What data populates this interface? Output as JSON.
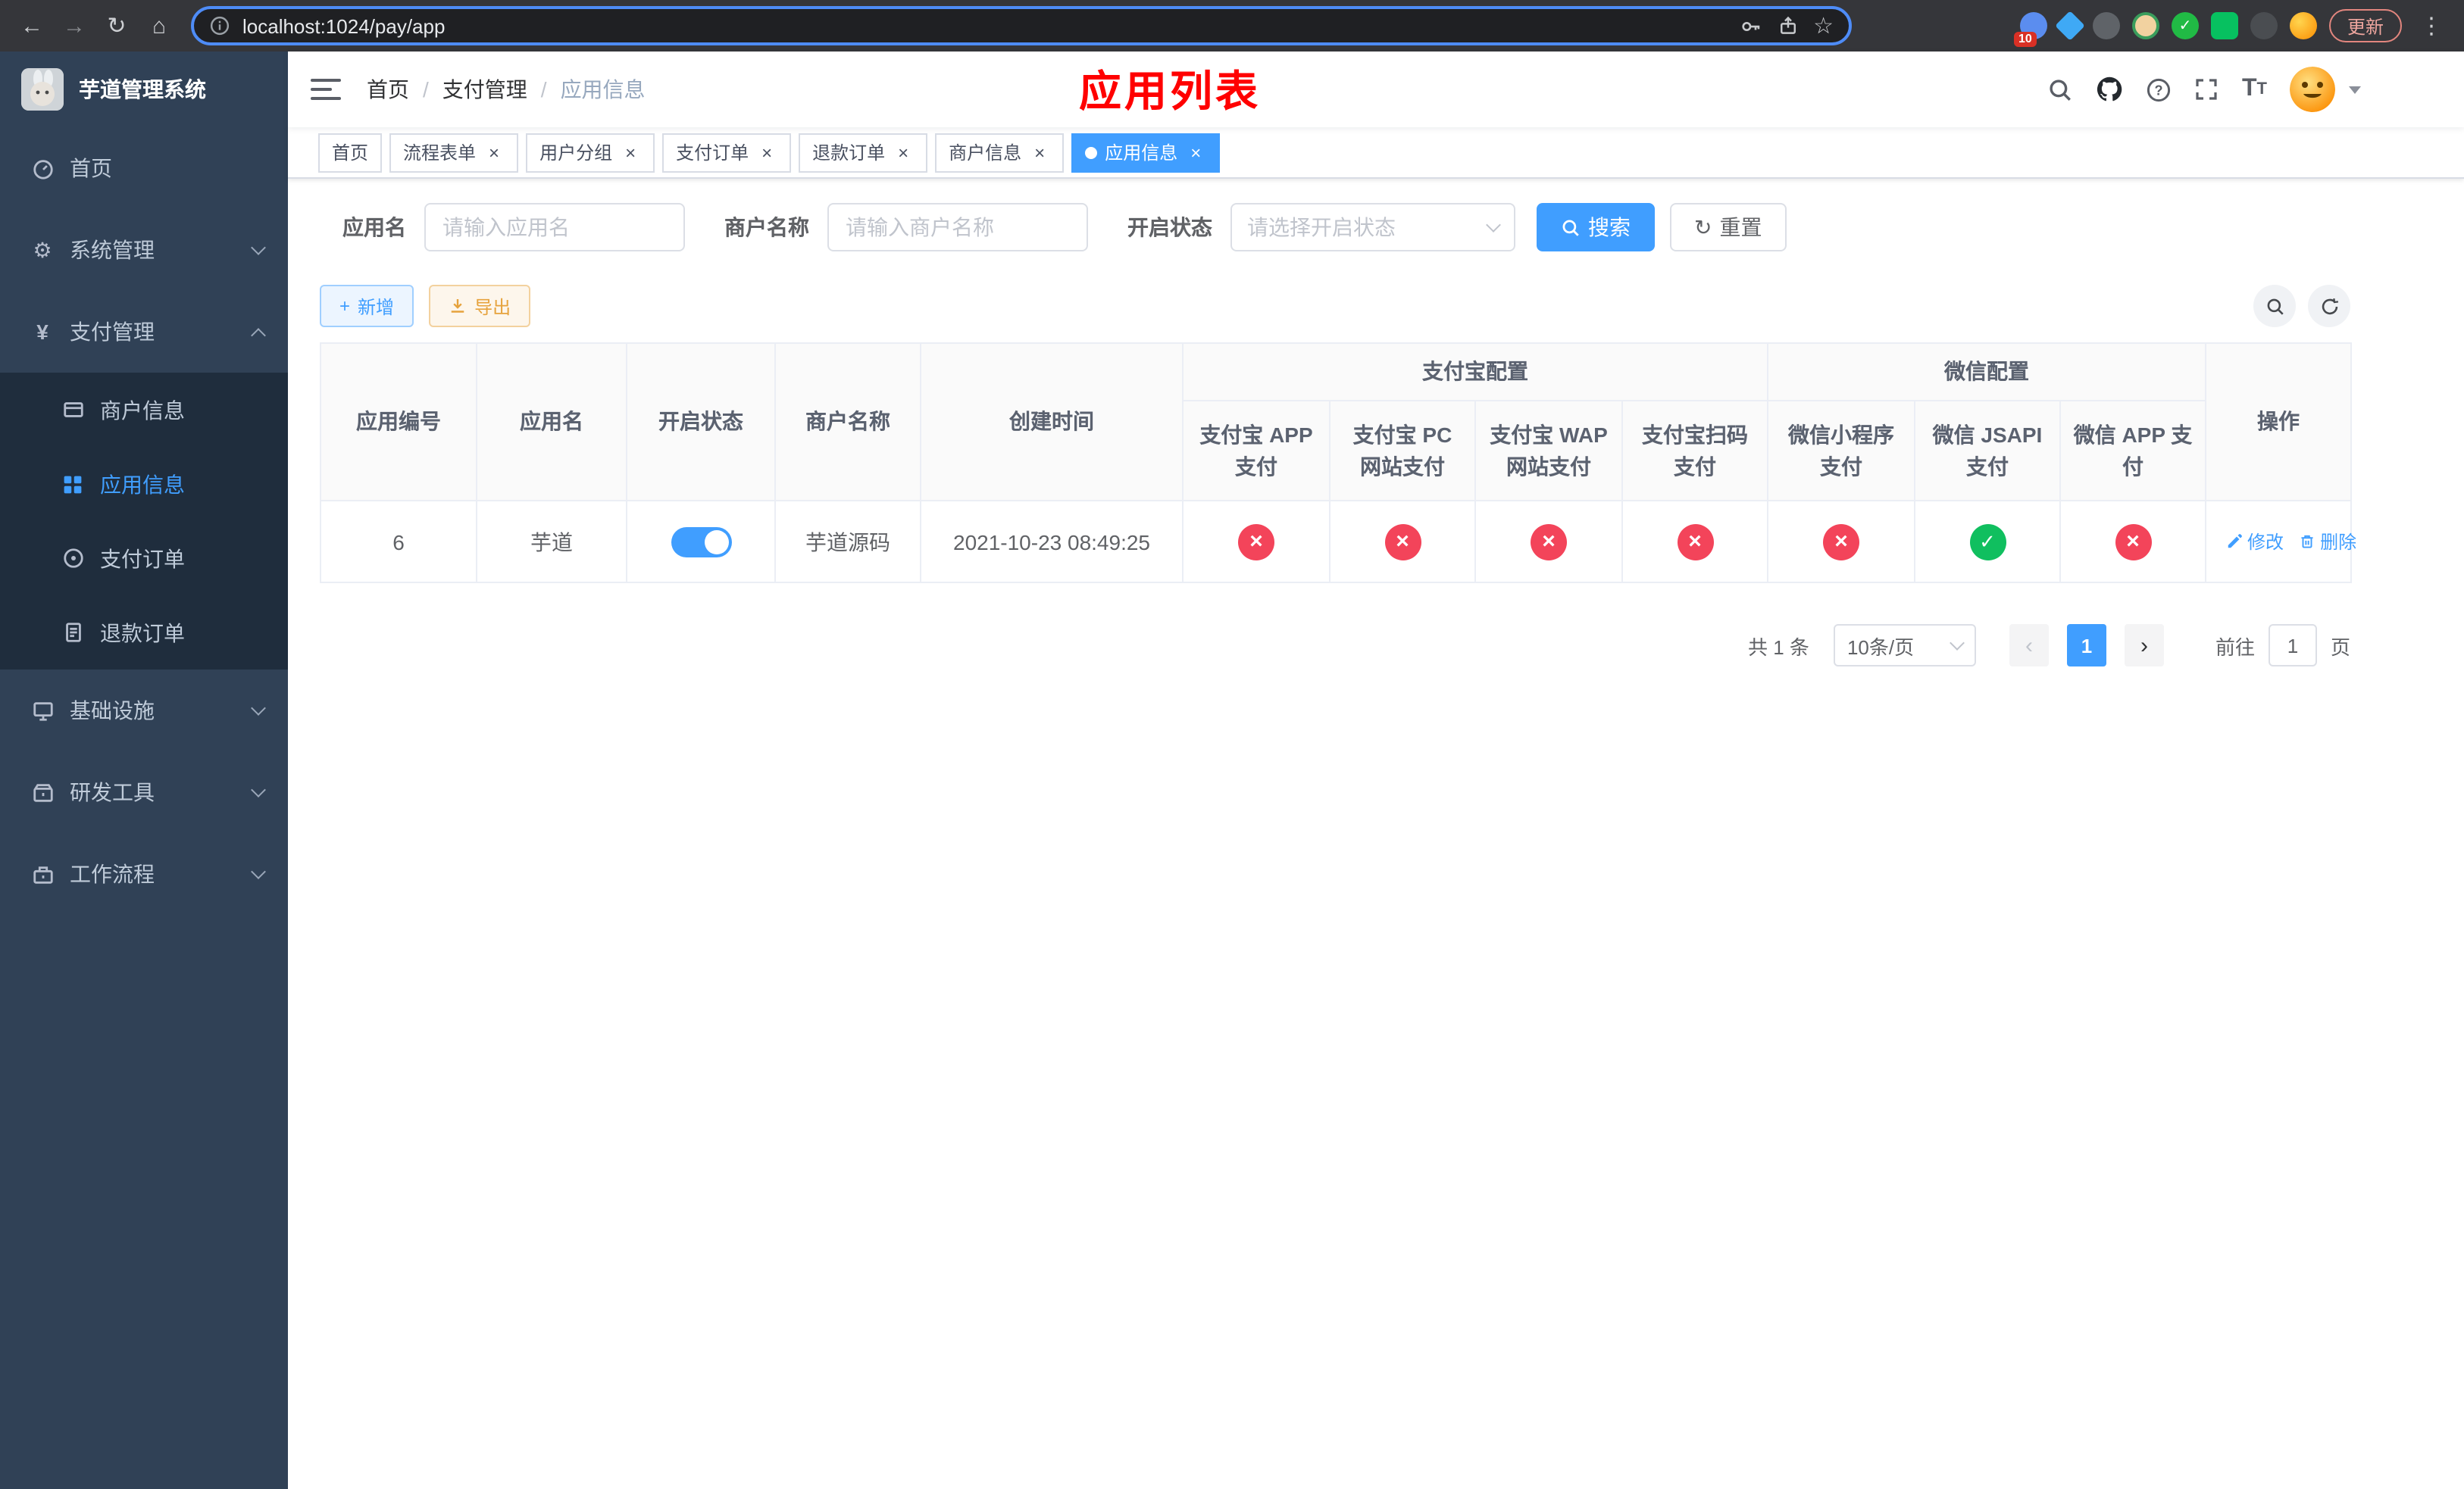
{
  "colors": {
    "primary": "#409eff",
    "success": "#10bf5f",
    "danger": "#f3445a",
    "warning": "#e6a23c",
    "page_title_red": "#ff0000",
    "sidebar_bg": "#304156",
    "submenu_bg": "#1f2d3d"
  },
  "icons": {
    "back": "←",
    "forward": "→",
    "reload": "↻",
    "home": "⌂",
    "star": "☆",
    "kebab": "⋮",
    "gear": "⚙",
    "yen": "¥",
    "reset": "↻",
    "prev": "‹",
    "next": "›",
    "close": "×",
    "plus": "+",
    "question": "?"
  },
  "browser": {
    "url": "localhost:1024/pay/app",
    "update_button": "更新",
    "extensions_badge": "10"
  },
  "sidebar": {
    "app_title": "芋道管理系统",
    "items": [
      {
        "label": "首页"
      },
      {
        "label": "系统管理"
      },
      {
        "label": "支付管理"
      },
      {
        "label": "基础设施"
      },
      {
        "label": "研发工具"
      },
      {
        "label": "工作流程"
      }
    ],
    "payment_children": [
      {
        "label": "商户信息"
      },
      {
        "label": "应用信息"
      },
      {
        "label": "支付订单"
      },
      {
        "label": "退款订单"
      }
    ]
  },
  "header": {
    "breadcrumb": [
      "首页",
      "支付管理",
      "应用信息"
    ],
    "page_title": "应用列表"
  },
  "tabs": [
    {
      "label": "首页"
    },
    {
      "label": "流程表单"
    },
    {
      "label": "用户分组"
    },
    {
      "label": "支付订单"
    },
    {
      "label": "退款订单"
    },
    {
      "label": "商户信息"
    },
    {
      "label": "应用信息"
    }
  ],
  "filters": {
    "app_name_label": "应用名",
    "app_name_placeholder": "请输入应用名",
    "merchant_label": "商户名称",
    "merchant_placeholder": "请输入商户名称",
    "status_label": "开启状态",
    "status_placeholder": "请选择开启状态",
    "search_button": "搜索",
    "reset_button": "重置"
  },
  "actions": {
    "add": "新增",
    "export": "导出"
  },
  "table": {
    "columns": {
      "id": "应用编号",
      "name": "应用名",
      "status": "开启状态",
      "merchant": "商户名称",
      "created": "创建时间",
      "alipay_group": "支付宝配置",
      "wechat_group": "微信配置",
      "alipay_app": "支付宝 APP 支付",
      "alipay_pc": "支付宝 PC 网站支付",
      "alipay_wap": "支付宝 WAP 网站支付",
      "alipay_qr": "支付宝扫码支付",
      "wx_lite": "微信小程序支付",
      "wx_jsapi": "微信 JSAPI 支付",
      "wx_app": "微信 APP 支付",
      "ops": "操作"
    },
    "rows": [
      {
        "id": "6",
        "name": "芋道",
        "enabled": true,
        "merchant": "芋道源码",
        "created": "2021-10-23 08:49:25",
        "alipay_app": false,
        "alipay_pc": false,
        "alipay_wap": false,
        "alipay_qr": false,
        "wx_lite": false,
        "wx_jsapi": true,
        "wx_app": false,
        "edit_label": "修改",
        "delete_label": "删除"
      }
    ]
  },
  "pagination": {
    "total": "共 1 条",
    "page_size": "10条/页",
    "page": "1",
    "goto": "前往",
    "goto_value": "1",
    "unit": "页"
  }
}
